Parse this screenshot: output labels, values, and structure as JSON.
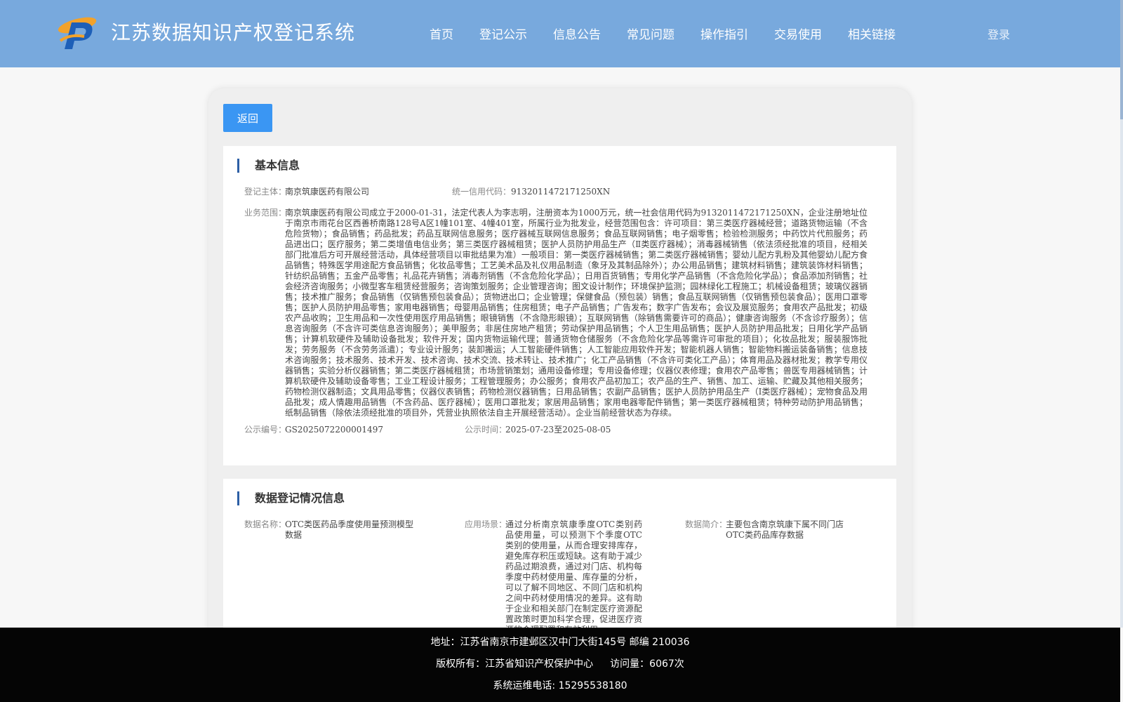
{
  "header": {
    "title": "江苏数据知识产权登记系统",
    "nav": [
      "首页",
      "登记公示",
      "信息公告",
      "常见问题",
      "操作指引",
      "交易使用",
      "相关链接"
    ],
    "login": "登录"
  },
  "actions": {
    "back_label": "返回"
  },
  "basic": {
    "title": "基本信息",
    "subject_label": "登记主体：",
    "subject_value": "南京筑康医药有限公司",
    "credit_label": "统一信用代码：",
    "credit_value": "9132011472171250XN",
    "scope_label": "业务范围：",
    "scope_value": "南京筑康医药有限公司成立于2000-01-31，法定代表人为李志明，注册资本为1000万元，统一社会信用代码为9132011472171250XN，企业注册地址位于南京市雨花台区西善桥南路128号A区1幢101室、4幢401室，所属行业为批发业，经营范围包含：许可项目：第三类医疗器械经营；道路货物运输（不含危险货物）；食品销售；药品批发；药品互联网信息服务；医疗器械互联网信息服务；食品互联网销售；电子烟零售；检验检测服务；中药饮片代煎服务；药品进出口；医疗服务；第二类增值电信业务；第三类医疗器械租赁；医护人员防护用品生产（Ⅱ类医疗器械）；消毒器械销售（依法须经批准的项目，经相关部门批准后方可开展经营活动，具体经营项目以审批结果为准）一般项目：第一类医疗器械销售；第二类医疗器械销售；婴幼儿配方乳粉及其他婴幼儿配方食品销售；特殊医学用途配方食品销售；化妆品零售；工艺美术品及礼仪用品制造（象牙及其制品除外）；办公用品销售；建筑材料销售；建筑装饰材料销售；针纺织品销售；五金产品零售；礼品花卉销售；消毒剂销售（不含危险化学品）；日用百货销售；专用化学产品销售（不含危险化学品）；食品添加剂销售；社会经济咨询服务；小微型客车租赁经营服务；咨询策划服务；企业管理咨询；图文设计制作；环境保护监测；园林绿化工程施工；机械设备租赁；玻璃仪器销售；技术推广服务；食品销售（仅销售预包装食品）；货物进出口；企业管理；保健食品（预包装）销售；食品互联网销售（仅销售预包装食品）；医用口罩零售；医护人员防护用品零售；家用电器销售；母婴用品销售；住房租赁；电子产品销售；广告发布；数字广告发布；会议及展览服务；食用农产品批发；初级农产品收购；卫生用品和一次性使用医疗用品销售；眼镜销售（不含隐形眼镜）；互联网销售（除销售需要许可的商品）；健康咨询服务（不含诊疗服务）；信息咨询服务（不含许可类信息咨询服务）；美甲服务；非居住房地产租赁；劳动保护用品销售；个人卫生用品销售；医护人员防护用品批发；日用化学产品销售；计算机软硬件及辅助设备批发；软件开发；国内货物运输代理；普通货物仓储服务（不含危险化学品等需许可审批的项目）；化妆品批发；服装服饰批发；劳务服务（不含劳务派遣）；专业设计服务；装卸搬运；人工智能硬件销售；人工智能应用软件开发；智能机器人销售；智能物料搬运装备销售；信息技术咨询服务；技术服务、技术开发、技术咨询、技术交流、技术转让、技术推广；化工产品销售（不含许可类化工产品）；体育用品及器材批发；教学专用仪器销售；实验分析仪器销售；第二类医疗器械租赁；市场营销策划；通用设备修理；专用设备修理；仪器仪表修理；食用农产品零售；兽医专用器械销售；计算机软硬件及辅助设备零售；工业工程设计服务；工程管理服务；办公服务；食用农产品初加工；农产品的生产、销售、加工、运输、贮藏及其他相关服务；药物检测仪器制造；文具用品零售；仪器仪表销售；药物检测仪器销售；日用品销售；农副产品销售；医护人员防护用品生产（Ⅰ类医疗器械）；宠物食品及用品批发；成人情趣用品销售（不含药品、医疗器械）；医用口罩批发；家居用品销售；家用电器零配件销售；第一类医疗器械租赁；特种劳动防护用品销售；纸制品销售（除依法须经批准的项目外，凭营业执照依法自主开展经营活动）。企业当前经营状态为存续。",
    "notice_no_label": "公示编号：",
    "notice_no_value": "GS2025072200001497",
    "notice_time_label": "公示时间：",
    "notice_time_value": "2025-07-23至2025-08-05"
  },
  "data_info": {
    "title": "数据登记情况信息",
    "name_label": "数据名称：",
    "name_value": "OTC类医药品季度使用量预测模型数据",
    "scene_label": "应用场景：",
    "scene_value": "通过分析南京筑康季度OTC类别药品使用量，可以预测下个季度OTC类别的使用量，从而合理安排库存，避免库存积压或短缺。这有助于减少药品过期浪费，通过对门店、机构每季度中药材使用量、库存量的分析，可以了解不同地区、不同门店和机构之间中药材使用情况的差异。这有助于企业和相关部门在制定医疗资源配置政策时更加科学合理，促进医疗资源的合理配置和有效利用。",
    "intro_label": "数据简介：",
    "intro_value": "主要包含南京筑康下属不同门店OTC类药品库存数据"
  },
  "footer": {
    "address": "地址：江苏省南京市建邺区汉中门大街145号 邮编 210036",
    "copyright": "版权所有：江苏省知识产权保护中心",
    "visits": "访问量：6067次",
    "phone": "系统运维电话: 15295538180"
  },
  "colors": {
    "header_bg": "#78a9dd",
    "button_blue": "#3a96f3",
    "section_accent": "#2d5fa5",
    "footer_bg": "#050505"
  }
}
